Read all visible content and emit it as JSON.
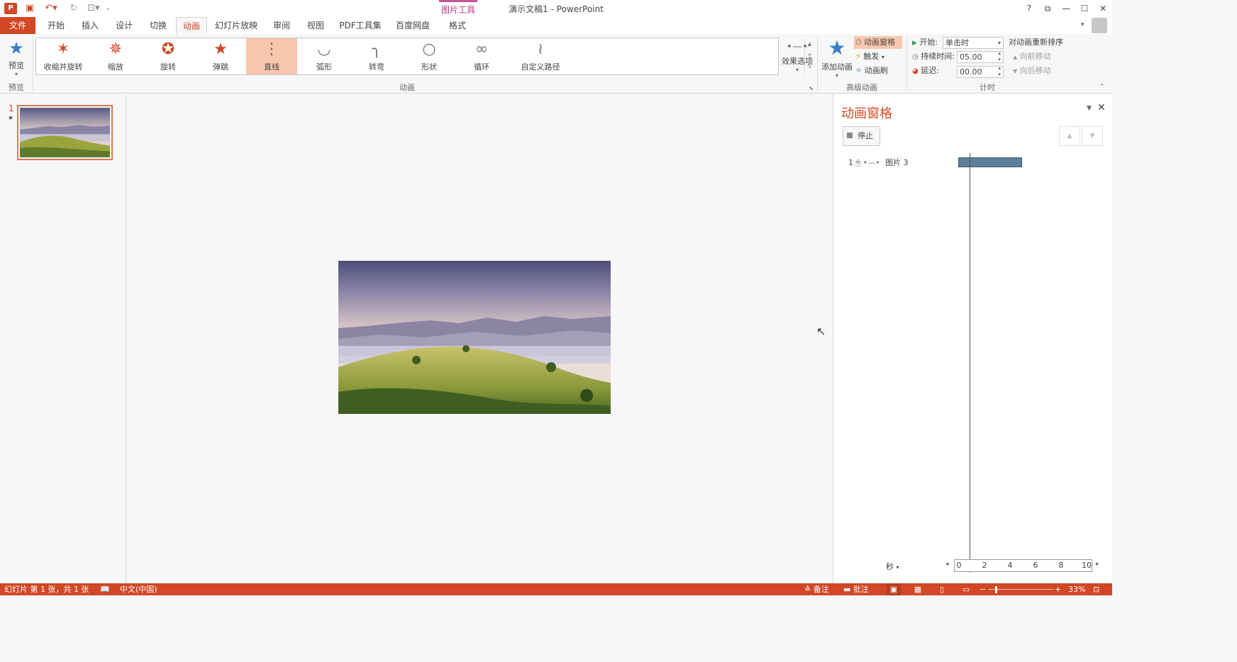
{
  "window": {
    "title": "演示文稿1 - PowerPoint",
    "contextual_tab": "图片工具",
    "app_logo": "P",
    "help": "?",
    "controls": [
      "?",
      "⧉",
      "—",
      "☐",
      "✕"
    ]
  },
  "tabs": [
    "文件",
    "开始",
    "插入",
    "设计",
    "切换",
    "动画",
    "幻灯片放映",
    "审阅",
    "视图",
    "PDF工具集",
    "百度网盘",
    "格式"
  ],
  "ribbon": {
    "preview_label": "预览",
    "preview_group": "预览",
    "animation_group": "动画",
    "gallery": [
      {
        "label": "收缩并旋转",
        "icon": "star-spin-icon"
      },
      {
        "label": "缩放",
        "icon": "star-zoom-icon"
      },
      {
        "label": "旋转",
        "icon": "star-rotate-icon"
      },
      {
        "label": "弹跳",
        "icon": "star-bounce-icon"
      },
      {
        "label": "直线",
        "icon": "line-path-icon"
      },
      {
        "label": "弧形",
        "icon": "arc-path-icon"
      },
      {
        "label": "转弯",
        "icon": "turn-path-icon"
      },
      {
        "label": "形状",
        "icon": "circle-path-icon"
      },
      {
        "label": "循环",
        "icon": "loop-path-icon"
      },
      {
        "label": "自定义路径",
        "icon": "custom-path-icon"
      }
    ],
    "effect_options": "效果选项",
    "advanced_group": "高级动画",
    "add_animation": "添加动画",
    "animation_pane": "动画窗格",
    "trigger": "触发",
    "animation_painter": "动画刷",
    "timing_group": "计时",
    "start_label": "开始:",
    "start_value": "单击时",
    "duration_label": "持续时间:",
    "duration_value": "05.00",
    "delay_label": "延迟:",
    "delay_value": "00.00",
    "reorder_title": "对动画重新排序",
    "move_earlier": "向前移动",
    "move_later": "向后移动"
  },
  "slides_panel": {
    "slide_number": "1",
    "anim_marker": "★"
  },
  "pane": {
    "title": "动画窗格",
    "stop": "停止",
    "item_index": "1",
    "item_name": "图片 3",
    "seconds_label": "秒",
    "ruler_ticks": [
      "0",
      "2",
      "4",
      "6",
      "8",
      "10"
    ]
  },
  "status": {
    "slide_info": "幻灯片 第 1 张，共 1 张",
    "language": "中文(中国)",
    "notes": "备注",
    "comments": "批注",
    "zoom": "33%"
  },
  "colors": {
    "accent": "#d24726",
    "selected_gallery": "#f9c7ae",
    "timebar": "#5d7f99",
    "contextual": "#b3398a"
  }
}
